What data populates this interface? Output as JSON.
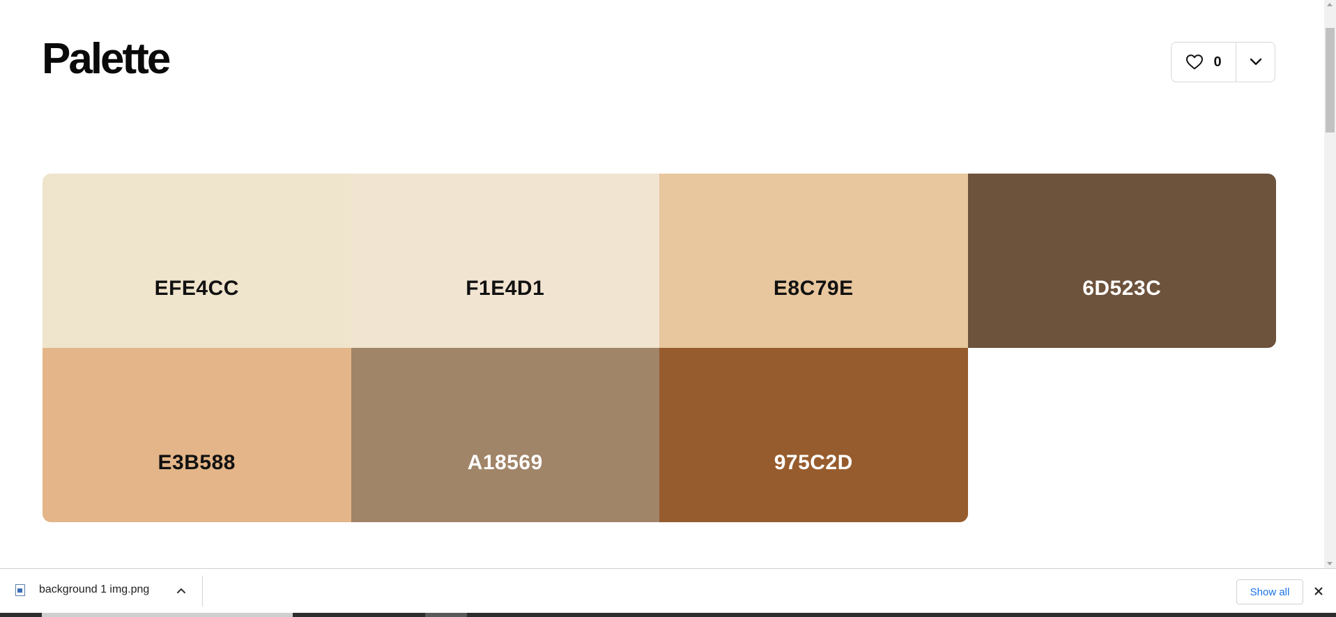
{
  "page": {
    "title": "Palette"
  },
  "like_control": {
    "count": "0",
    "icon": "heart-icon",
    "menu_icon": "chevron-down-icon"
  },
  "palette": {
    "swatches": [
      {
        "label": "EFE4CC",
        "bg": "#EFE4CC",
        "text_color": "#111111"
      },
      {
        "label": "F1E4D1",
        "bg": "#F1E4D1",
        "text_color": "#111111"
      },
      {
        "label": "E8C79E",
        "bg": "#E8C79E",
        "text_color": "#111111"
      },
      {
        "label": "6D523C",
        "bg": "#6D523C",
        "text_color": "#ffffff"
      },
      {
        "label": "E3B588",
        "bg": "#E3B588",
        "text_color": "#111111"
      },
      {
        "label": "A18569",
        "bg": "#A18569",
        "text_color": "#ffffff"
      },
      {
        "label": "975C2D",
        "bg": "#975C2D",
        "text_color": "#ffffff"
      }
    ]
  },
  "download_bar": {
    "file_name": "background 1 img.png",
    "show_all_label": "Show all"
  }
}
